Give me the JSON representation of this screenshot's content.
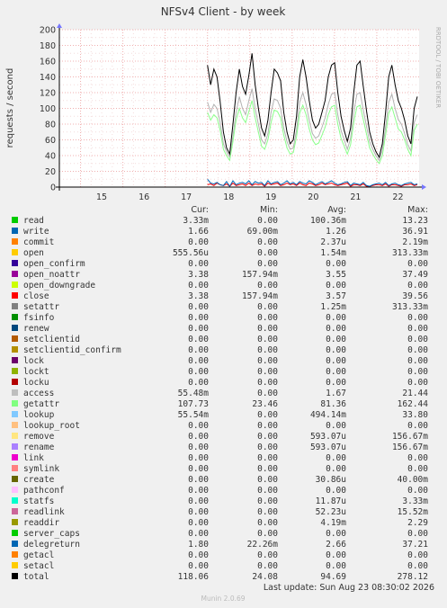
{
  "chart_data": {
    "type": "line",
    "title": "NFSv4 Client - by week",
    "ylabel": "requests / second",
    "watermark": "RRDTOOL / TOBI OETIKER",
    "ylim": [
      0,
      200
    ],
    "y_ticks": [
      "0",
      "20",
      "40",
      "60",
      "80",
      "100",
      "120",
      "140",
      "160",
      "180",
      "200"
    ],
    "x_ticks": [
      "15",
      "16",
      "17",
      "18",
      "19",
      "20",
      "21",
      "22"
    ],
    "grid": true,
    "data_start_tick": "18",
    "series": [
      {
        "name": "total",
        "color": "#000000",
        "values": [
          155,
          130,
          150,
          140,
          108,
          70,
          50,
          42,
          80,
          120,
          150,
          128,
          118,
          142,
          170,
          130,
          100,
          75,
          65,
          85,
          120,
          150,
          145,
          135,
          95,
          70,
          55,
          60,
          90,
          140,
          162,
          140,
          110,
          85,
          75,
          80,
          95,
          110,
          140,
          155,
          158,
          120,
          90,
          72,
          58,
          75,
          120,
          155,
          160,
          128,
          98,
          70,
          55,
          45,
          38,
          55,
          95,
          140,
          155,
          130,
          110,
          100,
          85,
          65,
          55,
          100,
          115
        ]
      },
      {
        "name": "access",
        "color": "#b2b2b2",
        "values": [
          108,
          95,
          105,
          100,
          82,
          55,
          45,
          38,
          65,
          95,
          115,
          100,
          92,
          110,
          125,
          100,
          80,
          60,
          55,
          68,
          95,
          112,
          110,
          100,
          75,
          58,
          48,
          50,
          72,
          108,
          120,
          105,
          85,
          68,
          62,
          65,
          76,
          88,
          105,
          118,
          120,
          92,
          72,
          60,
          48,
          62,
          95,
          118,
          120,
          98,
          78,
          58,
          48,
          40,
          34,
          46,
          76,
          108,
          118,
          100,
          86,
          80,
          68,
          54,
          46,
          82,
          92
        ]
      },
      {
        "name": "getattr",
        "color": "#8bff8b",
        "values": [
          95,
          85,
          92,
          88,
          72,
          48,
          40,
          34,
          58,
          85,
          100,
          88,
          82,
          96,
          110,
          88,
          70,
          52,
          48,
          60,
          82,
          98,
          96,
          88,
          66,
          50,
          42,
          44,
          64,
          94,
          104,
          92,
          74,
          60,
          54,
          56,
          66,
          76,
          92,
          102,
          104,
          80,
          62,
          52,
          42,
          54,
          82,
          102,
          104,
          86,
          68,
          50,
          42,
          35,
          30,
          40,
          66,
          94,
          102,
          88,
          74,
          70,
          60,
          48,
          40,
          72,
          80
        ]
      },
      {
        "name": "write",
        "color": "#0066b3",
        "values": [
          10,
          5,
          4,
          6,
          3,
          2,
          7,
          1,
          8,
          3,
          5,
          6,
          4,
          8,
          3,
          7,
          5,
          6,
          2,
          8,
          4,
          6,
          7,
          3,
          5,
          8,
          4,
          6,
          3,
          7,
          5,
          4,
          8,
          6,
          3,
          5,
          7,
          4,
          6,
          8,
          5,
          3,
          4,
          6,
          7,
          2,
          5,
          4,
          3,
          6,
          2,
          1,
          3,
          4,
          5,
          3,
          6,
          2,
          4,
          5,
          3,
          2,
          4,
          5,
          6,
          3,
          4
        ]
      },
      {
        "name": "close",
        "color": "#ff0000",
        "values": [
          3,
          4,
          2,
          5,
          3,
          2,
          4,
          1,
          5,
          2,
          3,
          4,
          2,
          5,
          2,
          4,
          3,
          4,
          1,
          5,
          3,
          4,
          5,
          2,
          3,
          5,
          3,
          4,
          2,
          5,
          3,
          2,
          5,
          4,
          2,
          3,
          5,
          3,
          4,
          5,
          3,
          2,
          3,
          4,
          5,
          1,
          3,
          3,
          2,
          4,
          1,
          1,
          2,
          3,
          3,
          2,
          4,
          1,
          3,
          3,
          2,
          1,
          3,
          3,
          4,
          2,
          3
        ]
      }
    ],
    "legend_headers": [
      "Cur:",
      "Min:",
      "Avg:",
      "Max:"
    ],
    "legend": [
      {
        "name": "read",
        "color": "#00cc00",
        "cur": "3.33m",
        "min": "0.00",
        "avg": "100.36m",
        "max": "13.23"
      },
      {
        "name": "write",
        "color": "#0066b3",
        "cur": "1.66",
        "min": "69.00m",
        "avg": "1.26",
        "max": "36.91"
      },
      {
        "name": "commit",
        "color": "#ff8000",
        "cur": "0.00",
        "min": "0.00",
        "avg": "2.37u",
        "max": "2.19m"
      },
      {
        "name": "open",
        "color": "#ffcc00",
        "cur": "555.56u",
        "min": "0.00",
        "avg": "1.54m",
        "max": "313.33m"
      },
      {
        "name": "open_confirm",
        "color": "#330099",
        "cur": "0.00",
        "min": "0.00",
        "avg": "0.00",
        "max": "0.00"
      },
      {
        "name": "open_noattr",
        "color": "#990099",
        "cur": "3.38",
        "min": "157.94m",
        "avg": "3.55",
        "max": "37.49"
      },
      {
        "name": "open_downgrade",
        "color": "#ccff00",
        "cur": "0.00",
        "min": "0.00",
        "avg": "0.00",
        "max": "0.00"
      },
      {
        "name": "close",
        "color": "#ff0000",
        "cur": "3.38",
        "min": "157.94m",
        "avg": "3.57",
        "max": "39.56"
      },
      {
        "name": "setattr",
        "color": "#808080",
        "cur": "0.00",
        "min": "0.00",
        "avg": "1.25m",
        "max": "313.33m"
      },
      {
        "name": "fsinfo",
        "color": "#008f00",
        "cur": "0.00",
        "min": "0.00",
        "avg": "0.00",
        "max": "0.00"
      },
      {
        "name": "renew",
        "color": "#00487d",
        "cur": "0.00",
        "min": "0.00",
        "avg": "0.00",
        "max": "0.00"
      },
      {
        "name": "setclientid",
        "color": "#b35a00",
        "cur": "0.00",
        "min": "0.00",
        "avg": "0.00",
        "max": "0.00"
      },
      {
        "name": "setclientid_confirm",
        "color": "#b38f00",
        "cur": "0.00",
        "min": "0.00",
        "avg": "0.00",
        "max": "0.00"
      },
      {
        "name": "lock",
        "color": "#6b006b",
        "cur": "0.00",
        "min": "0.00",
        "avg": "0.00",
        "max": "0.00"
      },
      {
        "name": "lockt",
        "color": "#8fb300",
        "cur": "0.00",
        "min": "0.00",
        "avg": "0.00",
        "max": "0.00"
      },
      {
        "name": "locku",
        "color": "#b30000",
        "cur": "0.00",
        "min": "0.00",
        "avg": "0.00",
        "max": "0.00"
      },
      {
        "name": "access",
        "color": "#bebebe",
        "cur": "55.48m",
        "min": "0.00",
        "avg": "1.67",
        "max": "21.44"
      },
      {
        "name": "getattr",
        "color": "#80ff80",
        "cur": "107.73",
        "min": "23.46",
        "avg": "81.36",
        "max": "162.44"
      },
      {
        "name": "lookup",
        "color": "#80c9ff",
        "cur": "55.54m",
        "min": "0.00",
        "avg": "494.14m",
        "max": "33.80"
      },
      {
        "name": "lookup_root",
        "color": "#ffc080",
        "cur": "0.00",
        "min": "0.00",
        "avg": "0.00",
        "max": "0.00"
      },
      {
        "name": "remove",
        "color": "#ffe680",
        "cur": "0.00",
        "min": "0.00",
        "avg": "593.07u",
        "max": "156.67m"
      },
      {
        "name": "rename",
        "color": "#aa80ff",
        "cur": "0.00",
        "min": "0.00",
        "avg": "593.07u",
        "max": "156.67m"
      },
      {
        "name": "link",
        "color": "#ee00cc",
        "cur": "0.00",
        "min": "0.00",
        "avg": "0.00",
        "max": "0.00"
      },
      {
        "name": "symlink",
        "color": "#ff8080",
        "cur": "0.00",
        "min": "0.00",
        "avg": "0.00",
        "max": "0.00"
      },
      {
        "name": "create",
        "color": "#666600",
        "cur": "0.00",
        "min": "0.00",
        "avg": "30.86u",
        "max": "40.00m"
      },
      {
        "name": "pathconf",
        "color": "#ffbfff",
        "cur": "0.00",
        "min": "0.00",
        "avg": "0.00",
        "max": "0.00"
      },
      {
        "name": "statfs",
        "color": "#00ffcc",
        "cur": "0.00",
        "min": "0.00",
        "avg": "11.87u",
        "max": "3.33m"
      },
      {
        "name": "readlink",
        "color": "#cc6699",
        "cur": "0.00",
        "min": "0.00",
        "avg": "52.23u",
        "max": "15.52m"
      },
      {
        "name": "readdir",
        "color": "#999900",
        "cur": "0.00",
        "min": "0.00",
        "avg": "4.19m",
        "max": "2.29"
      },
      {
        "name": "server_caps",
        "color": "#00cc00",
        "cur": "0.00",
        "min": "0.00",
        "avg": "0.00",
        "max": "0.00"
      },
      {
        "name": "delegreturn",
        "color": "#0066b3",
        "cur": "1.80",
        "min": "22.26m",
        "avg": "2.66",
        "max": "37.21"
      },
      {
        "name": "getacl",
        "color": "#ff8000",
        "cur": "0.00",
        "min": "0.00",
        "avg": "0.00",
        "max": "0.00"
      },
      {
        "name": "setacl",
        "color": "#ffcc00",
        "cur": "0.00",
        "min": "0.00",
        "avg": "0.00",
        "max": "0.00"
      },
      {
        "name": "total",
        "color": "#000000",
        "cur": "118.06",
        "min": "24.08",
        "avg": "94.69",
        "max": "278.12"
      }
    ],
    "last_update": "Last update: Sun Aug 23 08:30:02 2026",
    "footer": "Munin 2.0.69"
  }
}
